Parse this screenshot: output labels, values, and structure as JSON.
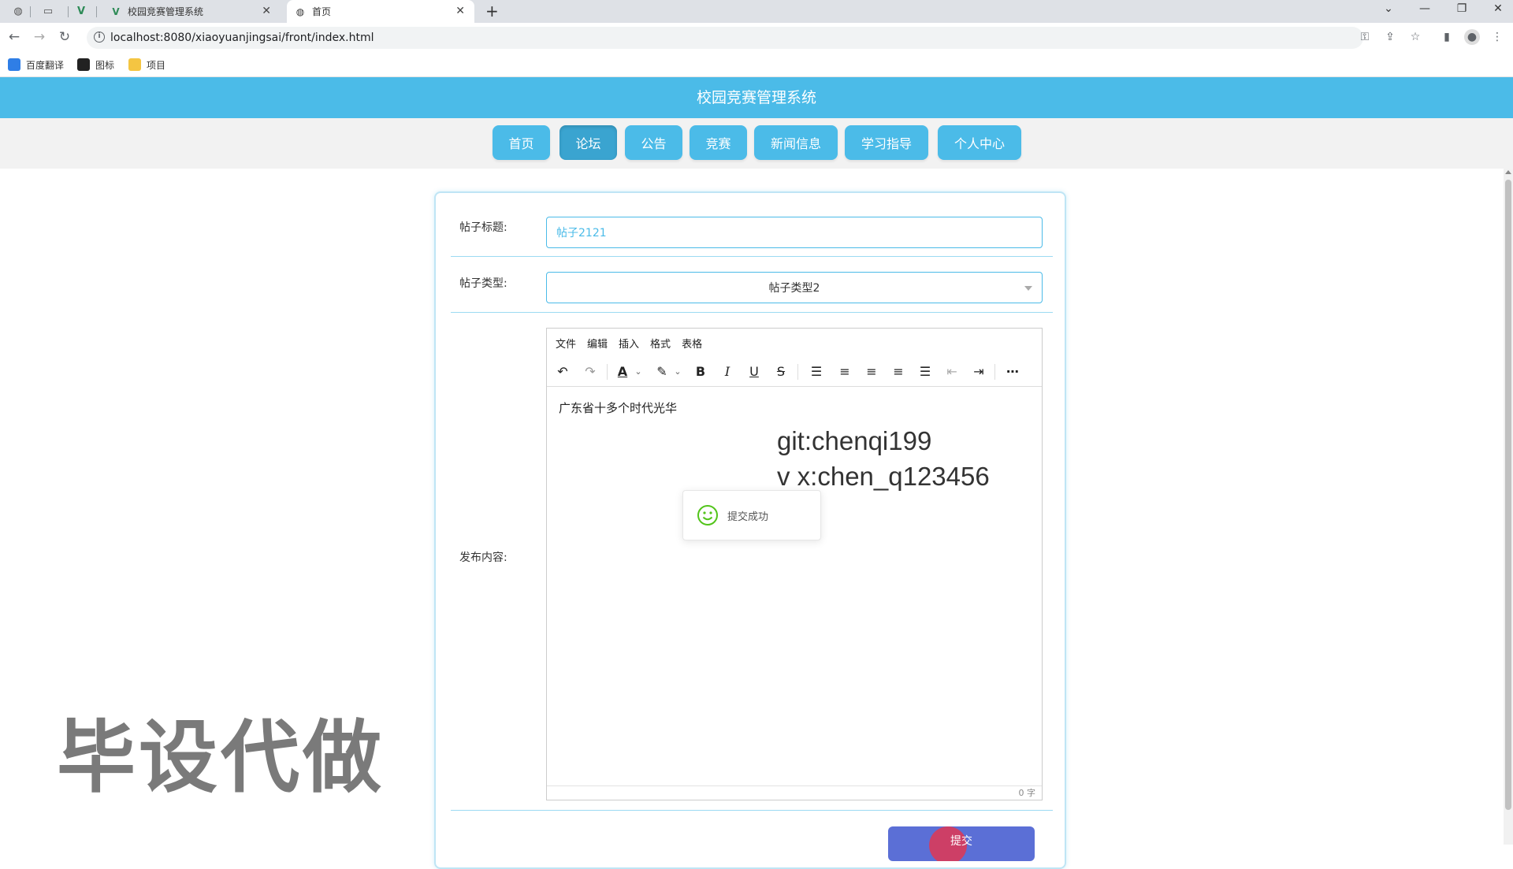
{
  "browser": {
    "tabs": [
      {
        "title": "校园竞赛管理系统",
        "active": false
      },
      {
        "title": "首页",
        "active": true
      }
    ],
    "url": "localhost:8080/xiaoyuanjingsai/front/index.html",
    "bookmarks": [
      "百度翻译",
      "图标",
      "项目"
    ]
  },
  "site": {
    "title": "校园竞赛管理系统",
    "nav": [
      "首页",
      "论坛",
      "公告",
      "竞赛",
      "新闻信息",
      "学习指导",
      "个人中心"
    ],
    "active_nav": "论坛"
  },
  "form": {
    "title_label": "帖子标题:",
    "title_value": "帖子2121",
    "type_label": "帖子类型:",
    "type_value": "帖子类型2",
    "content_label": "发布内容:",
    "editor_menu": [
      "文件",
      "编辑",
      "插入",
      "格式",
      "表格"
    ],
    "editor_text": "广东省十多个时代光华",
    "word_count": "0 字",
    "submit_label": "提交"
  },
  "toast": {
    "message": "提交成功",
    "icon": "smile-icon"
  },
  "overlay": {
    "git_line1": "git:chenqi199",
    "git_line2": "v x:chen_q123456",
    "watermark": "毕设代做"
  },
  "colors": {
    "accent": "#4bbbe8",
    "submit": "#5b6fd6",
    "toast_icon": "#52c41a"
  }
}
